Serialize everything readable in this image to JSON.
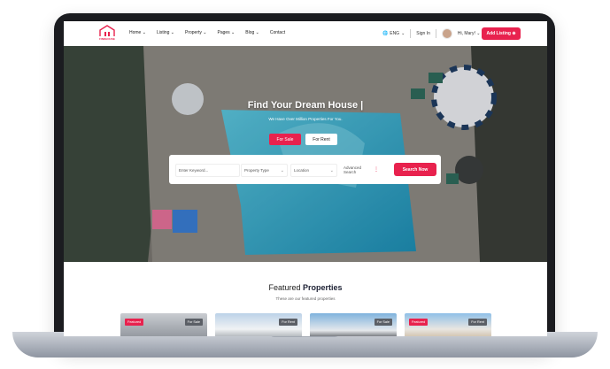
{
  "header": {
    "logo_text": "FINDHOUSE",
    "nav": [
      {
        "label": "Home",
        "has_dropdown": true
      },
      {
        "label": "Listing",
        "has_dropdown": true
      },
      {
        "label": "Property",
        "has_dropdown": true
      },
      {
        "label": "Pages",
        "has_dropdown": true
      },
      {
        "label": "Blog",
        "has_dropdown": true
      },
      {
        "label": "Contact",
        "has_dropdown": false
      }
    ],
    "language": "ENG",
    "sign_in": "Sign In",
    "greeting": "Hi, Mary!",
    "add_listing": "Add Listing"
  },
  "hero": {
    "title": "Find Your Dream House |",
    "subtitle": "We Have Over Million Properties For You.",
    "tabs": [
      {
        "label": "For Sale",
        "active": true
      },
      {
        "label": "For Rent",
        "active": false
      }
    ],
    "search": {
      "keyword_placeholder": "Enter Keyword...",
      "property_type": "Property Type",
      "location": "Location",
      "advanced": "Advanced Search",
      "button": "Search Now"
    }
  },
  "featured": {
    "title_plain": "Featured",
    "title_bold": "Properties",
    "subtitle": "These are our featured properties",
    "cards": [
      {
        "featured_badge": "Featured",
        "type_badge": "For Sale"
      },
      {
        "featured_badge": "",
        "type_badge": "For Rent"
      },
      {
        "featured_badge": "",
        "type_badge": "For Sale"
      },
      {
        "featured_badge": "Featured",
        "type_badge": "For Rent"
      }
    ]
  },
  "colors": {
    "accent": "#e8224e",
    "pool": "#2fa3c4",
    "deck": "#8b8780"
  }
}
